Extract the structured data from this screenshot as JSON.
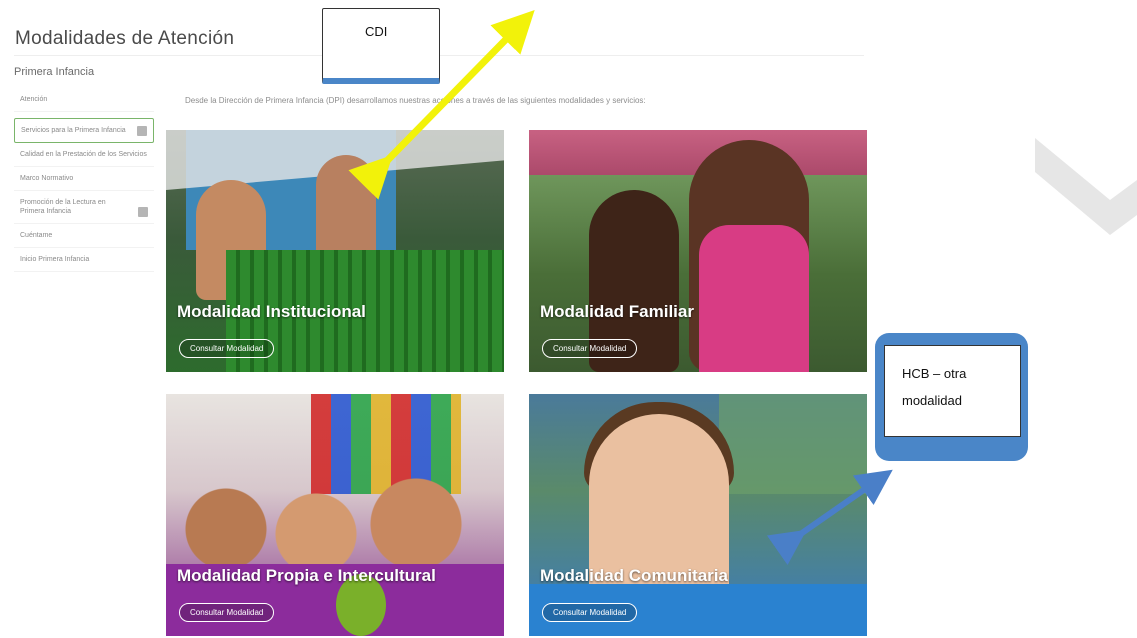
{
  "header": {
    "title": "Modalidades de Atención"
  },
  "sidebar": {
    "group_title": "Primera Infancia",
    "items": [
      {
        "label": "Atención"
      },
      {
        "label": "Servicios para la Primera Infancia"
      },
      {
        "label": "Calidad en la Prestación de los Servicios"
      },
      {
        "label": "Marco Normativo"
      },
      {
        "label": "Promoción de la Lectura en Primera Infancia"
      },
      {
        "label": "Cuéntame"
      },
      {
        "label": "Inicio Primera Infancia"
      }
    ]
  },
  "main": {
    "intro": "Desde la Dirección de Primera Infancia (DPI) desarrollamos nuestras acciones a través de las siguientes modalidades y servicios:",
    "cards": [
      {
        "title": "Modalidad Institucional",
        "button": "Consultar Modalidad"
      },
      {
        "title": "Modalidad Familiar",
        "button": "Consultar Modalidad"
      },
      {
        "title": "Modalidad Propia e Intercultural",
        "button": "Consultar Modalidad"
      },
      {
        "title": "Modalidad Comunitaria",
        "button": "Consultar Modalidad"
      }
    ]
  },
  "annotations": {
    "cdi_label": "CDI",
    "hcb_line1": "HCB – otra",
    "hcb_line2": "modalidad",
    "colors": {
      "yellow_arrow": "#f2f20a",
      "blue_arrow": "#4a7fc8",
      "box_blue": "#4a86c8"
    }
  }
}
